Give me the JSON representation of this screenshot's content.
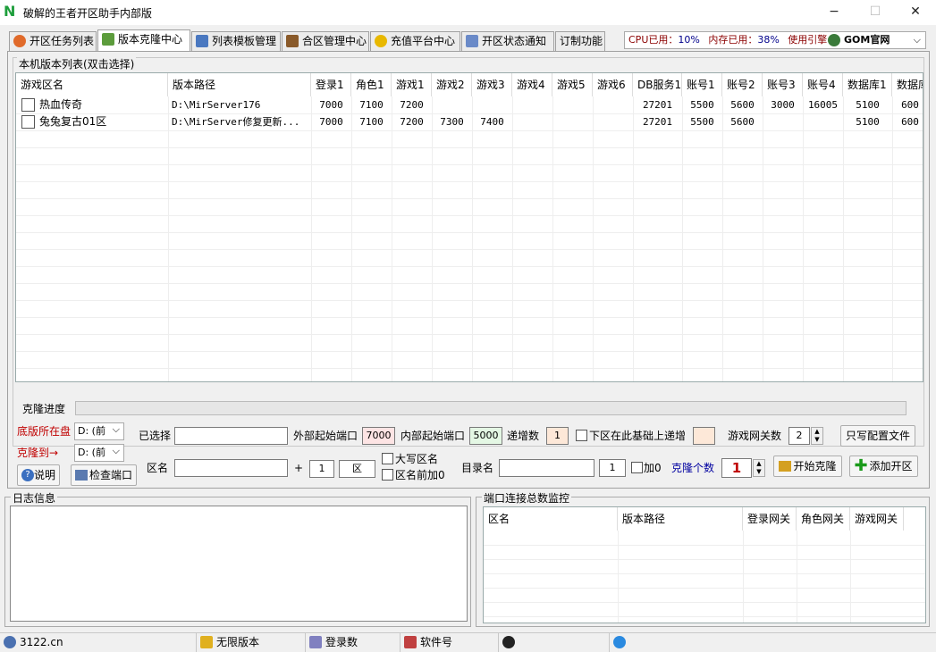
{
  "window": {
    "title": "破解的王者开区助手内部版",
    "min": "−",
    "max": "☐",
    "close": "✕"
  },
  "tabs": [
    {
      "label": "开区任务列表"
    },
    {
      "label": "版本克隆中心"
    },
    {
      "label": "列表模板管理"
    },
    {
      "label": "合区管理中心"
    },
    {
      "label": "充值平台中心"
    },
    {
      "label": "开区状态通知"
    },
    {
      "label": "订制功能"
    }
  ],
  "status": {
    "cpu_label": "CPU已用：",
    "cpu_value": "10%",
    "mem_label": "内存已用：",
    "mem_value": "38%",
    "engine_label": "使用引擎",
    "engine_value": "GOM官网"
  },
  "versions": {
    "title": "本机版本列表(双击选择)",
    "columns": [
      "游戏区名",
      "版本路径",
      "登录1",
      "角色1",
      "游戏1",
      "游戏2",
      "游戏3",
      "游戏4",
      "游戏5",
      "游戏6",
      "DB服务1",
      "账号1",
      "账号2",
      "账号3",
      "账号4",
      "数据库1",
      "数据库"
    ],
    "rows": [
      [
        "热血传奇",
        "D:\\MirServer176",
        "7000",
        "7100",
        "7200",
        "",
        "",
        "",
        "",
        "",
        "27201",
        "5500",
        "5600",
        "3000",
        "16005",
        "5100",
        "600"
      ],
      [
        "兔兔复古01区",
        "D:\\MirServer修复更新...",
        "7000",
        "7100",
        "7200",
        "7300",
        "7400",
        "",
        "",
        "",
        "27201",
        "5500",
        "5600",
        "",
        "",
        "5100",
        "600"
      ]
    ]
  },
  "clone": {
    "progress_label": "克隆进度",
    "progress_value": 0,
    "base_disk_label": "底版所在盘",
    "base_disk_value": "D: (前",
    "clone_to_label": "克隆到→",
    "clone_to_value": "D: (前",
    "help_btn": "说明",
    "check_port_btn": "检查端口",
    "selected_label": "已选择",
    "selected_value": "",
    "ext_port_label": "外部起始端口",
    "ext_port_value": "7000",
    "int_port_label": "内部起始端口",
    "int_port_value": "5000",
    "increment_label": "递增数",
    "increment_value": "1",
    "next_zone_label": "下区在此基础上递增",
    "gateway_count_label": "游戏网关数",
    "gateway_count_value": "2",
    "write_config_btn": "只写配置文件",
    "zone_name_label": "区名",
    "zone_name_value": "",
    "plus": "+",
    "zone_num_value": "1",
    "zone_suffix_value": "区",
    "upper_label": "大写区名",
    "prefix0_label": "区名前加0",
    "dir_name_label": "目录名",
    "dir_name_value": "",
    "dir_num_value": "1",
    "add0_label": "加0",
    "clone_count_label": "克隆个数",
    "clone_count_value": "1",
    "start_clone_btn": "开始克隆",
    "add_zone_btn": "添加开区"
  },
  "log": {
    "title": "日志信息"
  },
  "monitor": {
    "title": "端口连接总数监控",
    "columns": [
      "区名",
      "版本路径",
      "登录网关",
      "角色网关",
      "游戏网关"
    ]
  },
  "footer": {
    "site": "3122.cn",
    "unlimited": "无限版本",
    "login_count": "登录数",
    "software_no": "软件号"
  }
}
